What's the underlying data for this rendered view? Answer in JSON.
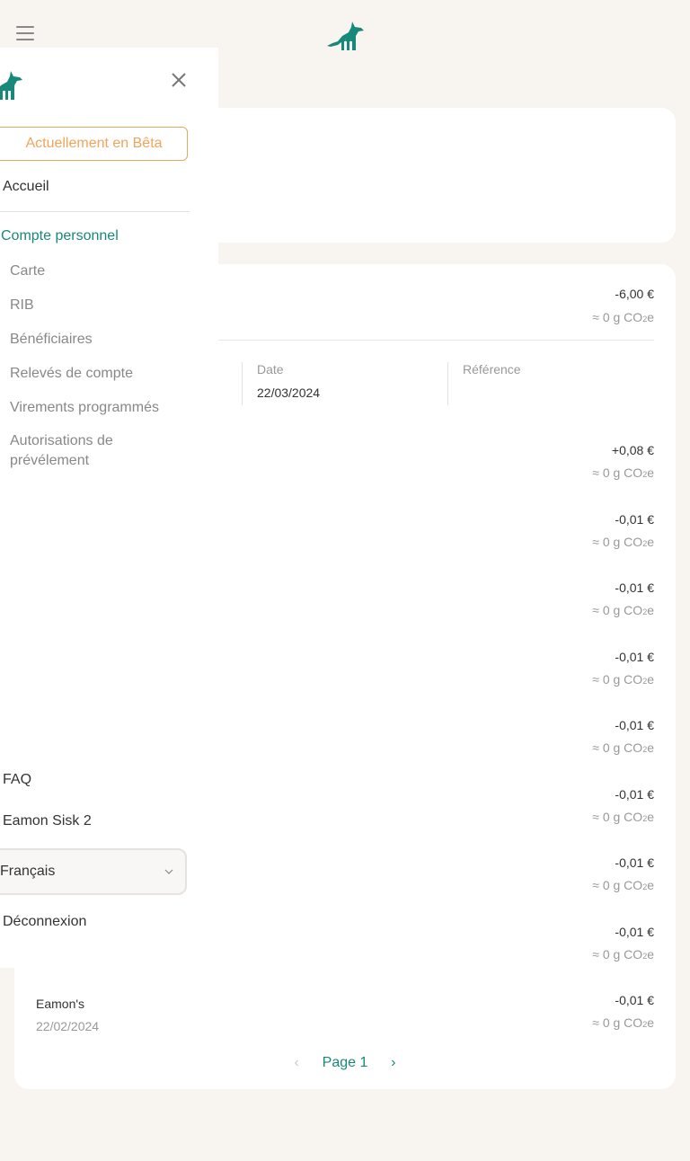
{
  "header": {
    "menu_icon": "hamburger-icon",
    "logo_icon": "fox-logo-icon"
  },
  "colors": {
    "brand": "#17897b",
    "beta": "#f0a55a",
    "background": "#f8f4ef"
  },
  "drawer": {
    "close_icon": "close-icon",
    "beta_label": "Actuellement en Bêta",
    "home_label": "Accueil",
    "section_label": "Compte personnel",
    "items": [
      {
        "label": "Carte"
      },
      {
        "label": "RIB"
      },
      {
        "label": "Bénéficiaires"
      },
      {
        "label": "Relevés de compte"
      },
      {
        "label": "Virements programmés"
      },
      {
        "label": "Autorisations de prévélement"
      }
    ],
    "faq_label": "FAQ",
    "user_name": "Eamon Sisk 2",
    "language": {
      "selected": "Français"
    },
    "logout_label": "Déconnexion"
  },
  "transactions": {
    "expanded": {
      "amount": "-6,00 €",
      "co2": "≈ 0 g CO",
      "co2_sub": "2",
      "co2_suffix": "e",
      "details": [
        {
          "label": "Date",
          "value": "22/03/2024"
        },
        {
          "label": "Référence",
          "value": ""
        }
      ]
    },
    "rows": [
      {
        "name": "",
        "date": "",
        "amount": "+0,08 €",
        "co2": "≈ 0 g CO",
        "co2_sub": "2",
        "co2_suffix": "e"
      },
      {
        "name": "",
        "date": "",
        "amount": "-0,01 €",
        "co2": "≈ 0 g CO",
        "co2_sub": "2",
        "co2_suffix": "e"
      },
      {
        "name": "",
        "date": "",
        "amount": "-0,01 €",
        "co2": "≈ 0 g CO",
        "co2_sub": "2",
        "co2_suffix": "e"
      },
      {
        "name": "",
        "date": "",
        "amount": "-0,01 €",
        "co2": "≈ 0 g CO",
        "co2_sub": "2",
        "co2_suffix": "e"
      },
      {
        "name": "",
        "date": "",
        "amount": "-0,01 €",
        "co2": "≈ 0 g CO",
        "co2_sub": "2",
        "co2_suffix": "e"
      },
      {
        "name": "",
        "date": "",
        "amount": "-0,01 €",
        "co2": "≈ 0 g CO",
        "co2_sub": "2",
        "co2_suffix": "e"
      },
      {
        "name": "",
        "date": "",
        "amount": "-0,01 €",
        "co2": "≈ 0 g CO",
        "co2_sub": "2",
        "co2_suffix": "e"
      },
      {
        "name": "",
        "date": "",
        "amount": "-0,01 €",
        "co2": "≈ 0 g CO",
        "co2_sub": "2",
        "co2_suffix": "e"
      },
      {
        "name": "Eamon's",
        "date": "22/02/2024",
        "amount": "-0,01 €",
        "co2": "≈ 0 g CO",
        "co2_sub": "2",
        "co2_suffix": "e"
      }
    ]
  },
  "pagination": {
    "prev_icon": "chevron-left-icon",
    "label": "Page 1",
    "next_icon": "chevron-right-icon"
  }
}
